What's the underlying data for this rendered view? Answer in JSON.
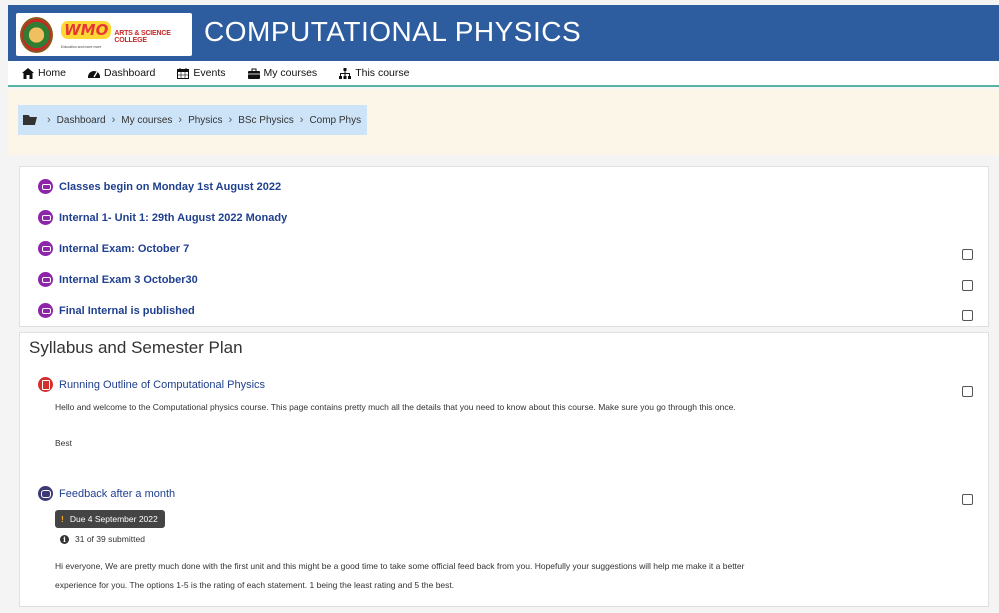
{
  "header": {
    "title": "COMPUTATIONAL PHYSICS",
    "logo": {
      "brand": "WMO",
      "college": "ARTS & SCIENCE COLLEGE",
      "tagline": "Education and more more"
    }
  },
  "nav": {
    "items": [
      {
        "label": "Home",
        "icon": "home-icon"
      },
      {
        "label": "Dashboard",
        "icon": "dashboard-icon"
      },
      {
        "label": "Events",
        "icon": "calendar-icon"
      },
      {
        "label": "My courses",
        "icon": "briefcase-icon"
      },
      {
        "label": "This course",
        "icon": "sitemap-icon"
      }
    ]
  },
  "breadcrumb": {
    "icon": "folder-open-icon",
    "items": [
      "Dashboard",
      "My courses",
      "Physics",
      "BSc Physics",
      "Comp Phys"
    ]
  },
  "announcements": [
    {
      "label": "Classes begin on Monday 1st August 2022",
      "has_checkbox": false
    },
    {
      "label": "Internal 1- Unit 1: 29th August 2022 Monady",
      "has_checkbox": false
    },
    {
      "label": "Internal Exam: October 7",
      "has_checkbox": true
    },
    {
      "label": "Internal Exam 3 October30",
      "has_checkbox": true
    },
    {
      "label": "Final Internal is published",
      "has_checkbox": true
    }
  ],
  "section": {
    "title": "Syllabus and Semester Plan",
    "activities": [
      {
        "label": "Running Outline of Computational Physics",
        "icon": "pdf-icon",
        "description": [
          "Hello and welcome to the Computational physics course. This page contains pretty much all the details that you need to know about this course. Make sure you go through this once.",
          "Best"
        ]
      },
      {
        "label": "Feedback after a month",
        "icon": "feedback-icon",
        "due": "Due 4 September 2022",
        "submitted": "31 of 39 submitted",
        "description": [
          "Hi everyone, We are pretty much done with the first unit and this might be a good time to take some official feed back from you. Hopefully your suggestions will help me make it a better",
          "experience for you. The options 1-5 is the rating of each statement. 1 being the least rating and 5 the best."
        ]
      }
    ]
  },
  "colors": {
    "header": "#2d5d9f",
    "nav_underline": "#57b4a5",
    "breadcrumb_bg": "#cde3f7",
    "forum_icon": "#8e24aa",
    "link": "#1f3f8f"
  }
}
